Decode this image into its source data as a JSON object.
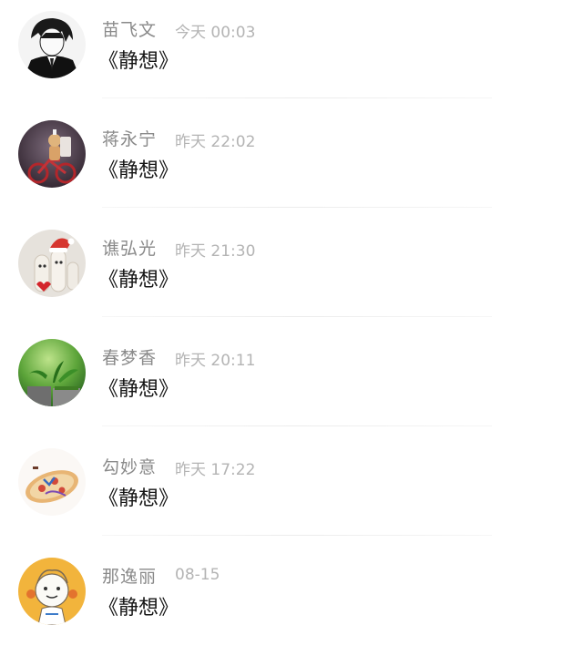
{
  "messages": [
    {
      "name": "苗飞文",
      "time": "今天 00:03",
      "text": "《静想》",
      "avatar": "anime-boy-avatar"
    },
    {
      "name": "蒋永宁",
      "time": "昨天 22:02",
      "text": "《静想》",
      "avatar": "bicycle-toy-avatar"
    },
    {
      "name": "谯弘光",
      "time": "昨天 21:30",
      "text": "《静想》",
      "avatar": "finger-puppets-avatar"
    },
    {
      "name": "春梦香",
      "time": "昨天 20:11",
      "text": "《静想》",
      "avatar": "green-plant-avatar"
    },
    {
      "name": "勾妙意",
      "time": "昨天 17:22",
      "text": "《静想》",
      "avatar": "pizza-avatar"
    },
    {
      "name": "那逸丽",
      "time": "08-15",
      "text": "《静想》",
      "avatar": "cartoon-character-avatar"
    }
  ]
}
